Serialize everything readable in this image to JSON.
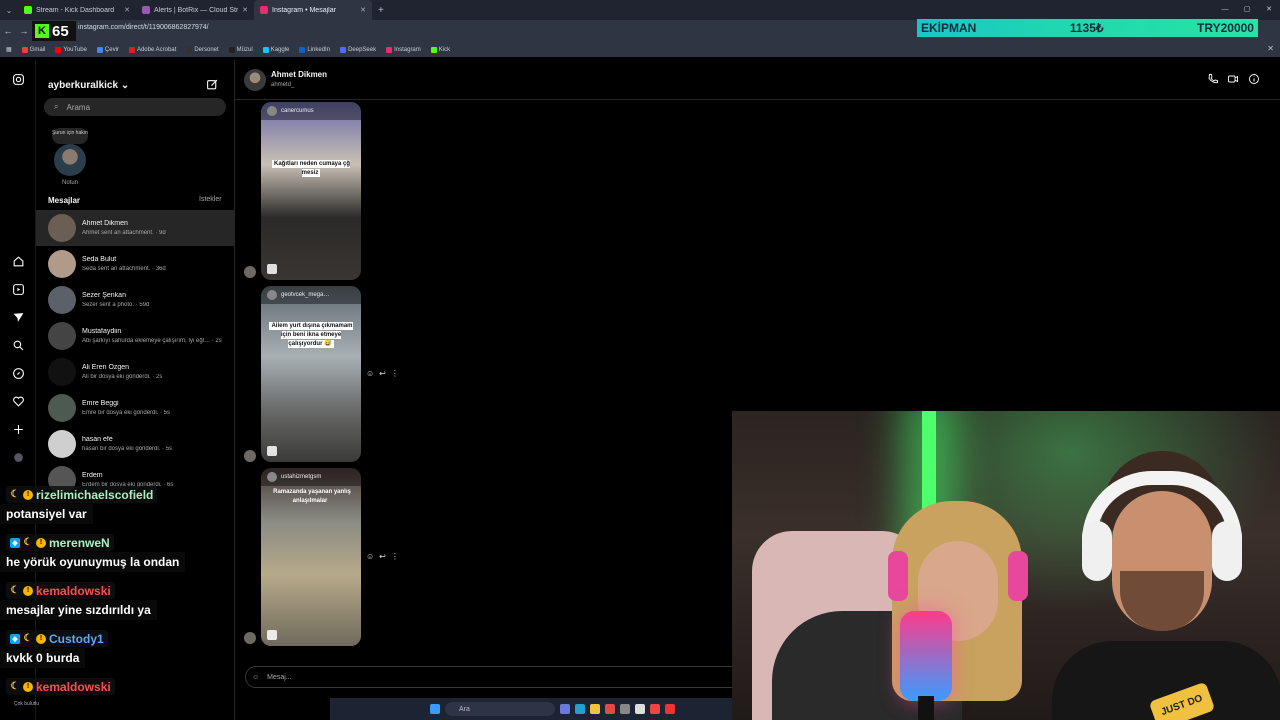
{
  "browser": {
    "tabs": [
      {
        "title": "Stream - Kick Dashboard",
        "color": "#53fc18"
      },
      {
        "title": "Alerts | BotRix — Cloud Streami…",
        "color": "#9b59b6"
      },
      {
        "title": "Instagram • Mesajlar",
        "color": "#e1306c"
      }
    ],
    "url": "instagram.com/direct/t/119006862827974/",
    "bookmarks": [
      "Gmail",
      "YouTube",
      "Çevir",
      "Adobe Acrobat",
      "Dersonet",
      "Müzul",
      "Kaggle",
      "LinkedIn",
      "DeepSeek",
      "Instagram",
      "Kick"
    ],
    "kick_count": "65"
  },
  "ekipman": {
    "label": "EKİPMAN",
    "progress": "1135₺",
    "target": "TRY20000"
  },
  "instagram": {
    "username": "ayberkuralkick",
    "search_placeholder": "Arama",
    "note": {
      "bubble": "Şurun için hakın",
      "label": "Notun"
    },
    "messages_heading": "Mesajlar",
    "requests_label": "İstekler",
    "threads": [
      {
        "name": "Ahmet Dikmen",
        "preview": "Ahmet sent an attachment. · 9d",
        "color": "#6b5f55"
      },
      {
        "name": "Seda Bulut",
        "preview": "Seda sent an attachment. · 36d",
        "color": "#b09a8a"
      },
      {
        "name": "Sezer Şenkan",
        "preview": "Sezer sent a photo. · 59d",
        "color": "#5c6068"
      },
      {
        "name": "Mustafaydiin",
        "preview": "Abi şarkıyı sahurda eklemeye çalışırım, İyi eğl… · 2s",
        "color": "#444"
      },
      {
        "name": "Ali Eren Özgen",
        "preview": "Ali bir dosya eki gönderdi. · 2s",
        "color": "#111"
      },
      {
        "name": "Emre Beggi",
        "preview": "Emre bir dosya eki gönderdi. · 5s",
        "color": "#4d5a52"
      },
      {
        "name": "hasan efe",
        "preview": "hasan bir dosya eki gönderdi. · 5s",
        "color": "#cfcfcf"
      },
      {
        "name": "Erdem",
        "preview": "Erdem bir dosya eki gönderdi. · 6s",
        "color": "#555"
      }
    ],
    "conversation": {
      "name": "Ahmet Dikmen",
      "username": "ahmetd_",
      "reels": [
        {
          "author": "canercumus",
          "caption": "Kağıtları neden cumaya çğ mesiz"
        },
        {
          "author": "geotvcek_mega…",
          "caption": "Ailem yurt dışına çıkmamam için beni ikna etmeye çalışıyordur 😅"
        },
        {
          "author": "ustahizmetgsm",
          "caption": "Ramazanda yaşanan yanlış anlaşılmalar"
        }
      ],
      "input_placeholder": "Mesaj..."
    }
  },
  "chat": [
    {
      "user": "rizelimichaelscofield",
      "user_color": "#a8f0c0",
      "message": "potansiyel var"
    },
    {
      "user": "merenweN",
      "user_color": "#a8f0c0",
      "message": "he yörük oyunuymuş la ondan"
    },
    {
      "user": "kemaldowski",
      "user_color": "#ff4d4d",
      "message": "mesajlar yine sızdırıldı ya"
    },
    {
      "user": "Custody1",
      "user_color": "#5aa8ff",
      "message": "kvkk 0 burda"
    },
    {
      "user": "kemaldowski",
      "user_color": "#ff4d4d",
      "message": ""
    }
  ],
  "taskbar": {
    "search": "Ara",
    "weather": "Çok bulutlu"
  },
  "webcam": {
    "shirt_text": "JUST DO"
  }
}
